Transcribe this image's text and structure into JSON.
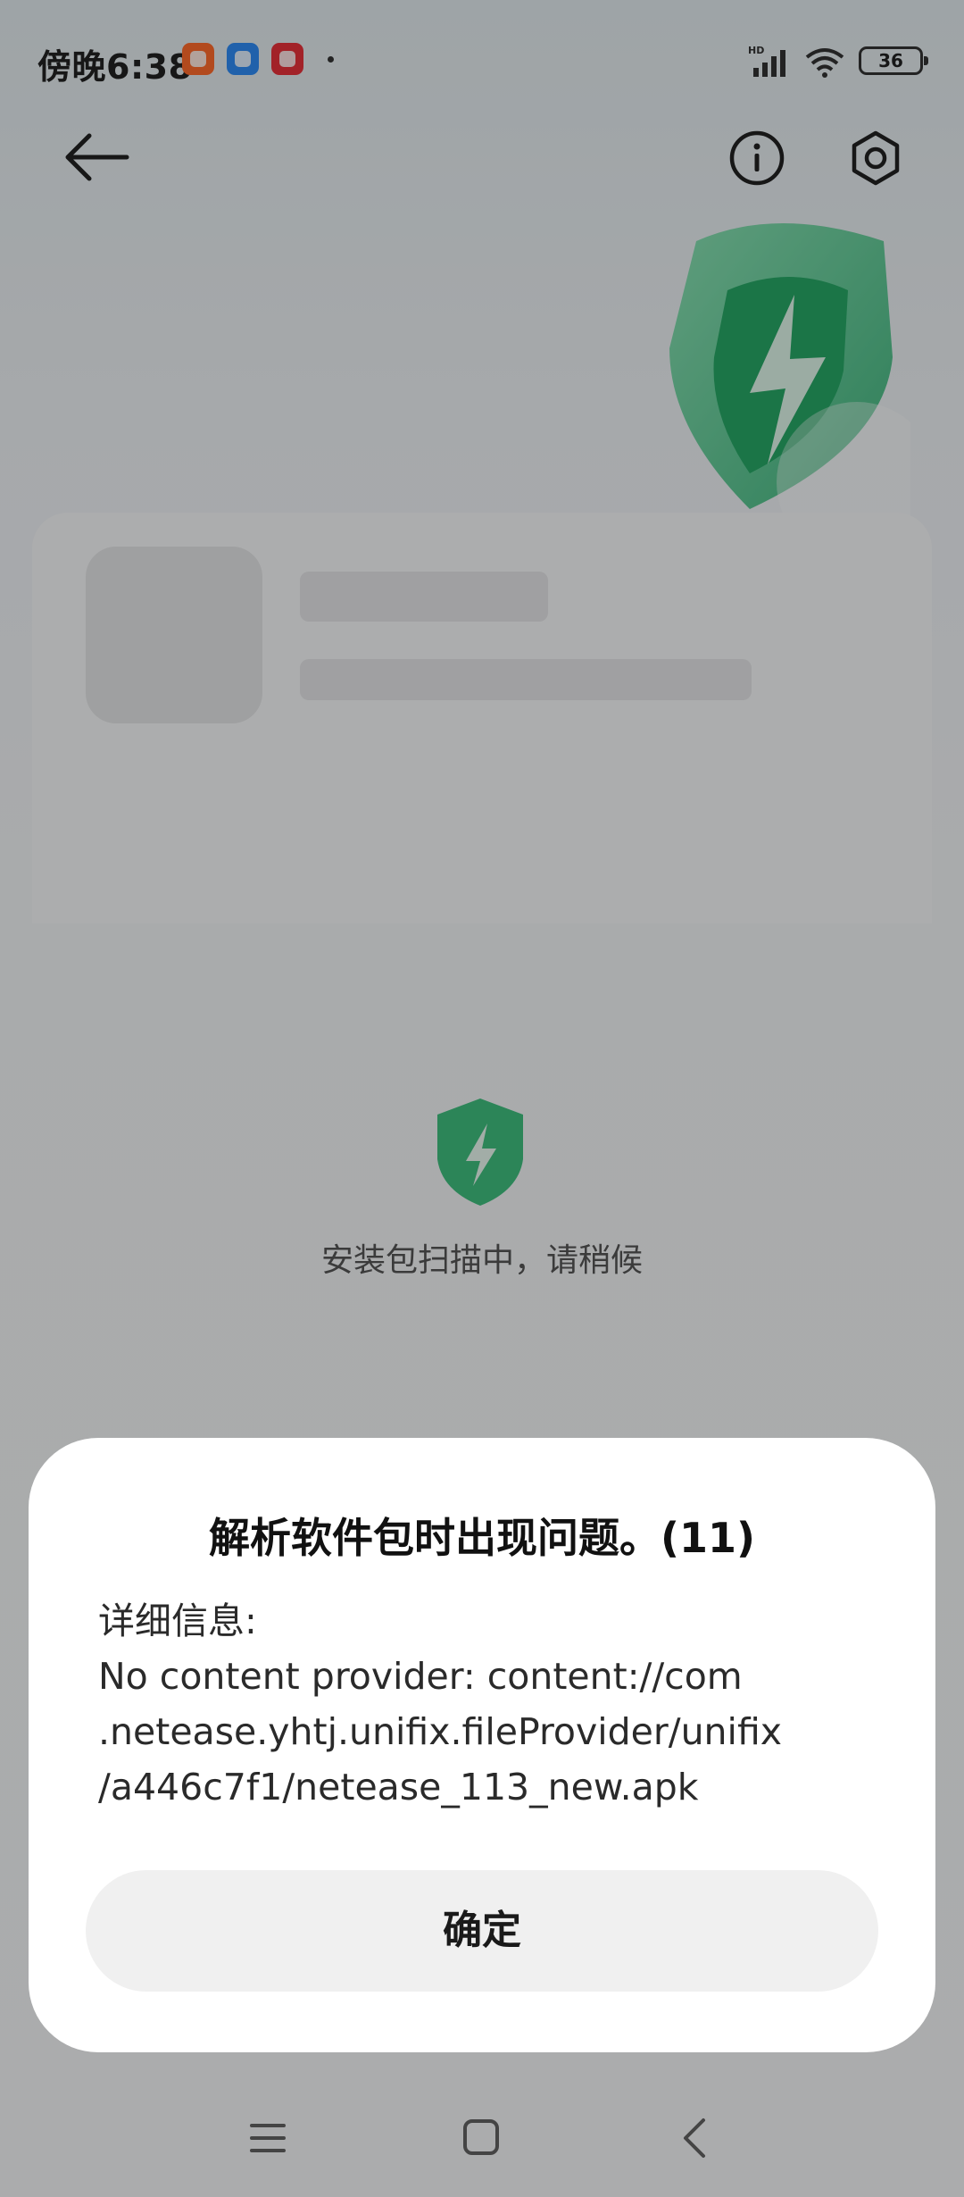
{
  "status_bar": {
    "time": "傍晚6:38",
    "battery": "36",
    "icons": [
      "taobao-app-icon",
      "messenger-app-icon",
      "news-app-icon",
      "signal-icon",
      "wifi-icon",
      "battery-icon"
    ]
  },
  "toolbar": {
    "icons": [
      "back-arrow-icon",
      "info-icon",
      "settings-icon"
    ]
  },
  "scan": {
    "status_text": "安装包扫描中，请稍候"
  },
  "dialog": {
    "title": "解析软件包时出现问题。(11)",
    "detail_lines": [
      "详细信息:",
      "No content provider: content://com",
      ".netease.yhtj.unifix.fileProvider/unifix",
      "/a446c7f1/netease_113_new.apk"
    ],
    "confirm_label": "确定"
  },
  "colors": {
    "accent_green": "#3fbf7f",
    "overlay": "rgba(0,0,0,0.30)"
  },
  "nav_bar": {
    "icons": [
      "menu-icon",
      "home-icon",
      "back-icon"
    ]
  }
}
